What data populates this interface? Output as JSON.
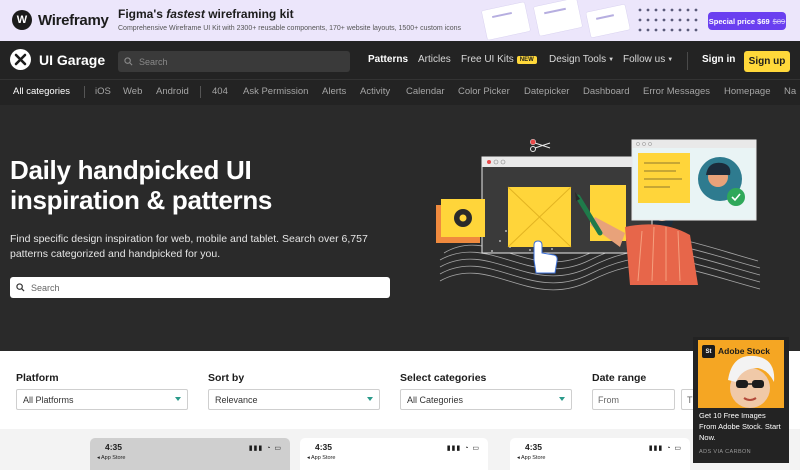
{
  "promo": {
    "brand": "Wireframy",
    "title_pre": "Figma's ",
    "title_em": "fastest",
    "title_post": " wireframing kit",
    "subtitle": "Comprehensive Wireframe UI Kit with 2300+ reusable components, 170+ website layouts, 1500+ custom icons",
    "price_label": "Special price $69",
    "old_price": "$89"
  },
  "nav": {
    "brand": "UI Garage",
    "search_placeholder": "Search",
    "links": [
      {
        "label": "Patterns",
        "active": true
      },
      {
        "label": "Articles"
      },
      {
        "label": "Free UI Kits",
        "badge": "NEW"
      },
      {
        "label": "Design Tools",
        "dropdown": true
      },
      {
        "label": "Follow us",
        "dropdown": true
      }
    ],
    "signin": "Sign in",
    "signup": "Sign up"
  },
  "categories": {
    "items": [
      "All categories",
      "iOS",
      "Web",
      "Android",
      "404",
      "Ask Permission",
      "Alerts",
      "Activity",
      "Calendar",
      "Color Picker",
      "Datepicker",
      "Dashboard",
      "Error Messages",
      "Homepage",
      "Na"
    ],
    "active_index": 0
  },
  "hero": {
    "title": "Daily handpicked UI inspiration & patterns",
    "description": "Find specific design inspiration for web, mobile and tablet. Search over 6,757 patterns categorized and handpicked for you.",
    "search_placeholder": "Search"
  },
  "filters": {
    "platform": {
      "label": "Platform",
      "value": "All Platforms"
    },
    "sort_by": {
      "label": "Sort by",
      "value": "Relevance"
    },
    "categories": {
      "label": "Select categories",
      "value": "All Categories"
    },
    "date_range": {
      "label": "Date range",
      "from_placeholder": "From",
      "to_placeholder": "T"
    }
  },
  "gallery": {
    "cards": [
      {
        "time": "4:35",
        "store": "◂ App Store"
      },
      {
        "time": "4:35",
        "store": "◂ App Store"
      },
      {
        "time": "4:35",
        "store": "◂ App Store"
      }
    ]
  },
  "ad": {
    "brand": "Adobe Stock",
    "brand_short": "St",
    "text": "Get 10 Free Images From Adobe Stock. Start Now.",
    "via": "ADS VIA CARBON"
  },
  "colors": {
    "accent_yellow": "#ffd83a",
    "promo_purple": "#6a3ff0",
    "dark_bg": "#2a2a2a",
    "teal": "#2a9a8a"
  }
}
